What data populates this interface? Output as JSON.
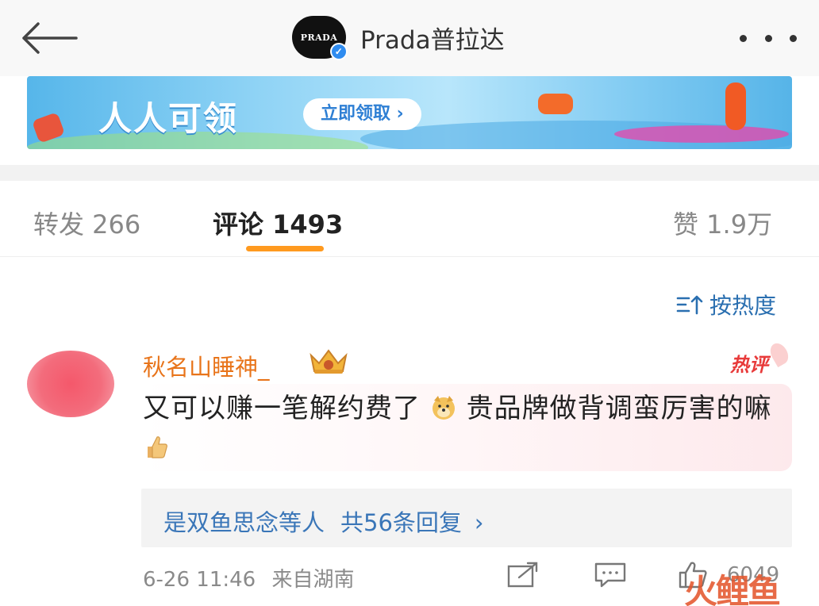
{
  "header": {
    "back_icon": "arrow-left-icon",
    "logo_text": "PRADA",
    "account_name": "Prada普拉达",
    "more_icon": "more-horizontal-icon"
  },
  "banner": {
    "headline": "人人可领",
    "cta": "立即领取 ›"
  },
  "tabs": {
    "repost": "转发 266",
    "comments": "评论 1493",
    "likes": "赞 1.9万"
  },
  "sort": {
    "icon": "sort-icon",
    "label": "按热度"
  },
  "comment": {
    "username": "秋名山睡神_",
    "hot_badge": "热评",
    "text_part1": "又可以赚一笔解约费了",
    "text_part2": "贵品牌做背调蛮厉害的嘛",
    "reply_author": "是双鱼思念等人",
    "reply_count": "共56条回复",
    "reply_chevron": "›",
    "timestamp": "6-26 11:46",
    "location": "来自湖南",
    "like_count": "6049"
  },
  "watermark": "火鲤鱼",
  "colors": {
    "username": "#e8741a",
    "link_blue": "#3a76b8",
    "tab_underline": "#ff9a1f",
    "hot_red": "#e83a3a"
  }
}
